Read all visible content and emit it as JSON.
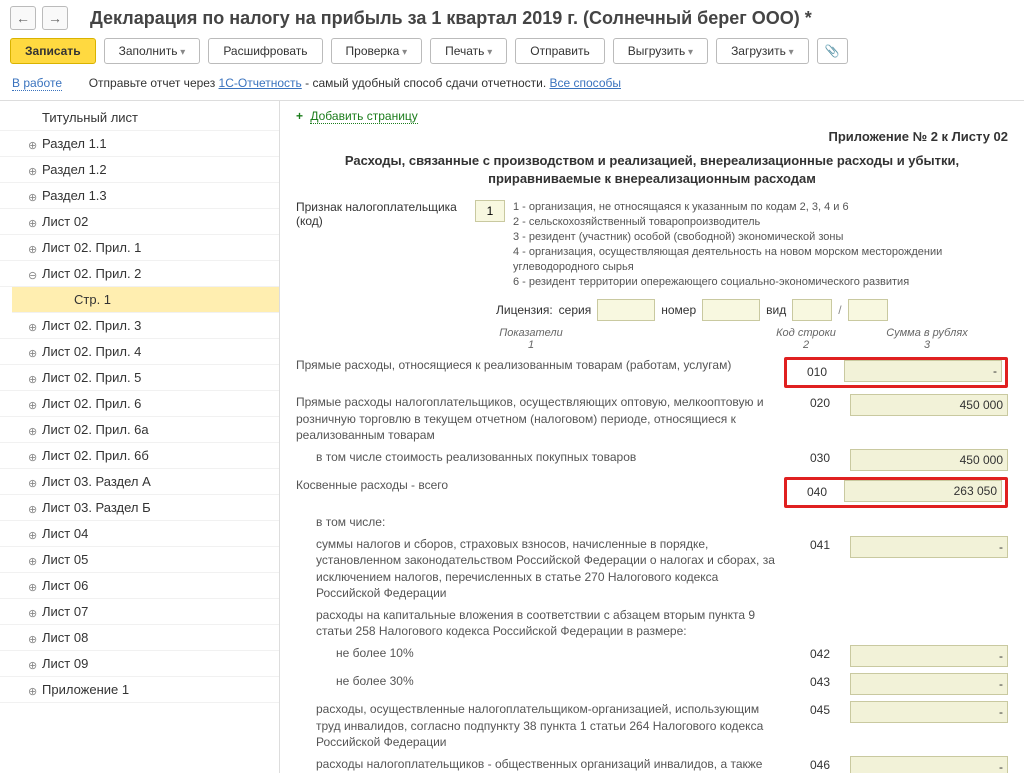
{
  "nav": {
    "back": "←",
    "forward": "→"
  },
  "page_title": "Декларация по налогу на прибыль за 1 квартал 2019 г. (Солнечный берег ООО) *",
  "toolbar": {
    "save": "Записать",
    "fill": "Заполнить",
    "decrypt": "Расшифровать",
    "check": "Проверка",
    "print": "Печать",
    "send": "Отправить",
    "export": "Выгрузить",
    "load": "Загрузить",
    "clip": "📎"
  },
  "status": {
    "in_work": "В работе",
    "msg1": "Отправьте отчет через",
    "link1": "1С-Отчетность",
    "msg2": "- самый удобный способ сдачи отчетности.",
    "link2": "Все способы"
  },
  "sidebar": {
    "items": [
      {
        "label": "Титульный лист"
      },
      {
        "label": "Раздел 1.1",
        "bullet": true
      },
      {
        "label": "Раздел 1.2",
        "bullet": true
      },
      {
        "label": "Раздел 1.3",
        "bullet": true
      },
      {
        "label": "Лист 02",
        "bullet": true
      },
      {
        "label": "Лист 02. Прил. 1",
        "bullet": true
      },
      {
        "label": "Лист 02. Прил. 2",
        "bullet": true,
        "expanded": true
      },
      {
        "label": "Стр. 1",
        "selected": true,
        "grandchild": true
      },
      {
        "label": "Лист 02. Прил. 3",
        "bullet": true
      },
      {
        "label": "Лист 02. Прил. 4",
        "bullet": true
      },
      {
        "label": "Лист 02. Прил. 5",
        "bullet": true
      },
      {
        "label": "Лист 02. Прил. 6",
        "bullet": true
      },
      {
        "label": "Лист 02. Прил. 6а",
        "bullet": true
      },
      {
        "label": "Лист 02. Прил. 6б",
        "bullet": true
      },
      {
        "label": "Лист 03. Раздел А",
        "bullet": true
      },
      {
        "label": "Лист 03. Раздел Б",
        "bullet": true
      },
      {
        "label": "Лист 04",
        "bullet": true
      },
      {
        "label": "Лист 05",
        "bullet": true
      },
      {
        "label": "Лист 06",
        "bullet": true
      },
      {
        "label": "Лист 07",
        "bullet": true
      },
      {
        "label": "Лист 08",
        "bullet": true
      },
      {
        "label": "Лист 09",
        "bullet": true
      },
      {
        "label": "Приложение 1",
        "bullet": true
      }
    ]
  },
  "main": {
    "add_page": "Добавить страницу",
    "attachment_title": "Приложение № 2 к Листу 02",
    "heading": "Расходы, связанные с производством и реализацией, внереализационные расходы и убытки, приравниваемые к внереализационным расходам",
    "taxpayer_label": "Признак налогоплательщика (код)",
    "taxpayer_code": "1",
    "taxpayer_notes": [
      "1 - организация, не относящаяся к указанным по кодам 2, 3, 4 и 6",
      "2 - сельскохозяйственный товаропроизводитель",
      "3 - резидент (участник) особой (свободной) экономической зоны",
      "4 - организация, осуществляющая деятельность на новом морском месторождении углеводородного сырья",
      "6 - резидент территории опережающего социально-экономического развития"
    ],
    "license": {
      "label": "Лицензия:",
      "series": "серия",
      "number": "номер",
      "type": "вид",
      "slash": "/"
    },
    "cols": {
      "indicator": "Показатели",
      "code": "Код строки",
      "sum": "Сумма в рублях",
      "n1": "1",
      "n2": "2",
      "n3": "3"
    },
    "rows": [
      {
        "label": "Прямые расходы, относящиеся к реализованным товарам (работам, услугам)",
        "code": "010",
        "value": "-",
        "highlight": true
      },
      {
        "label": "Прямые расходы налогоплательщиков, осуществляющих оптовую, мелкооптовую и розничную торговлю в текущем отчетном (налоговом) периоде, относящиеся к реализованным товарам",
        "code": "020",
        "value": "450 000"
      },
      {
        "label": "в том числе стоимость реализованных покупных товаров",
        "code": "030",
        "value": "450 000",
        "indent": 1
      },
      {
        "label": "Косвенные расходы - всего",
        "code": "040",
        "value": "263 050",
        "highlight": true
      },
      {
        "label": "в том числе:",
        "code": "",
        "value": null,
        "indent": 1,
        "noval": true
      },
      {
        "label": "суммы налогов и сборов, страховых взносов, начисленные в порядке, установленном законодательством Российской Федерации о налогах и сборах, за исключением налогов, перечисленных в статье 270 Налогового кодекса Российской Федерации",
        "code": "041",
        "value": "-",
        "indent": 1
      },
      {
        "label": "расходы на капитальные вложения в соответствии с абзацем вторым пункта 9 статьи 258 Налогового кодекса Российской Федерации в размере:",
        "code": "",
        "value": null,
        "indent": 1,
        "noval": true
      },
      {
        "label": "не более 10%",
        "code": "042",
        "value": "-",
        "indent": 2
      },
      {
        "label": "не более 30%",
        "code": "043",
        "value": "-",
        "indent": 2
      },
      {
        "label": "расходы, осуществленные налогоплательщиком-организацией, использующим труд инвалидов, согласно подпункту 38 пункта 1 статьи 264 Налогового кодекса Российской Федерации",
        "code": "045",
        "value": "-",
        "indent": 1
      },
      {
        "label": "расходы налогоплательщиков - общественных организаций инвалидов, а также налогоплательщиков-учреждений, единственными",
        "code": "046",
        "value": "-",
        "indent": 1
      }
    ]
  }
}
